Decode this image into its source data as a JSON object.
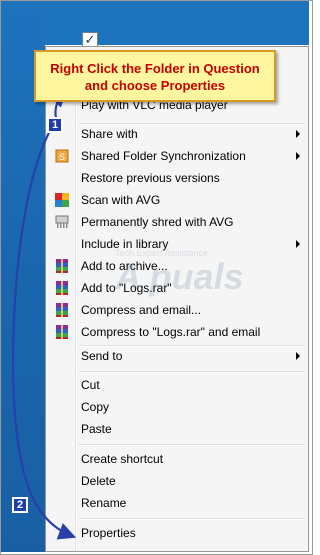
{
  "callout": {
    "line1": "Right Click the Folder in Question",
    "line2": "and choose Properties"
  },
  "watermark": {
    "small": "Tech Expert Assistance",
    "big": "A puals"
  },
  "steps": {
    "one": "1",
    "two": "2"
  },
  "menu": {
    "play_vlc": "Play with VLC media player",
    "share_with": "Share with",
    "shared_folder_sync": "Shared Folder Synchronization",
    "restore_previous": "Restore previous versions",
    "scan_avg": "Scan with AVG",
    "shred_avg": "Permanently shred with AVG",
    "include_library": "Include in library",
    "add_archive": "Add to archive...",
    "add_logs_rar": "Add to \"Logs.rar\"",
    "compress_email": "Compress and email...",
    "compress_logs_email": "Compress to \"Logs.rar\" and email",
    "send_to": "Send to",
    "cut": "Cut",
    "copy": "Copy",
    "paste": "Paste",
    "create_shortcut": "Create shortcut",
    "delete": "Delete",
    "rename": "Rename",
    "properties": "Properties"
  },
  "colors": {
    "accent_blue": "#1e73bd",
    "callout_text": "#c40000",
    "callout_bg": "#fff7a0",
    "arrow": "#2840a8"
  }
}
